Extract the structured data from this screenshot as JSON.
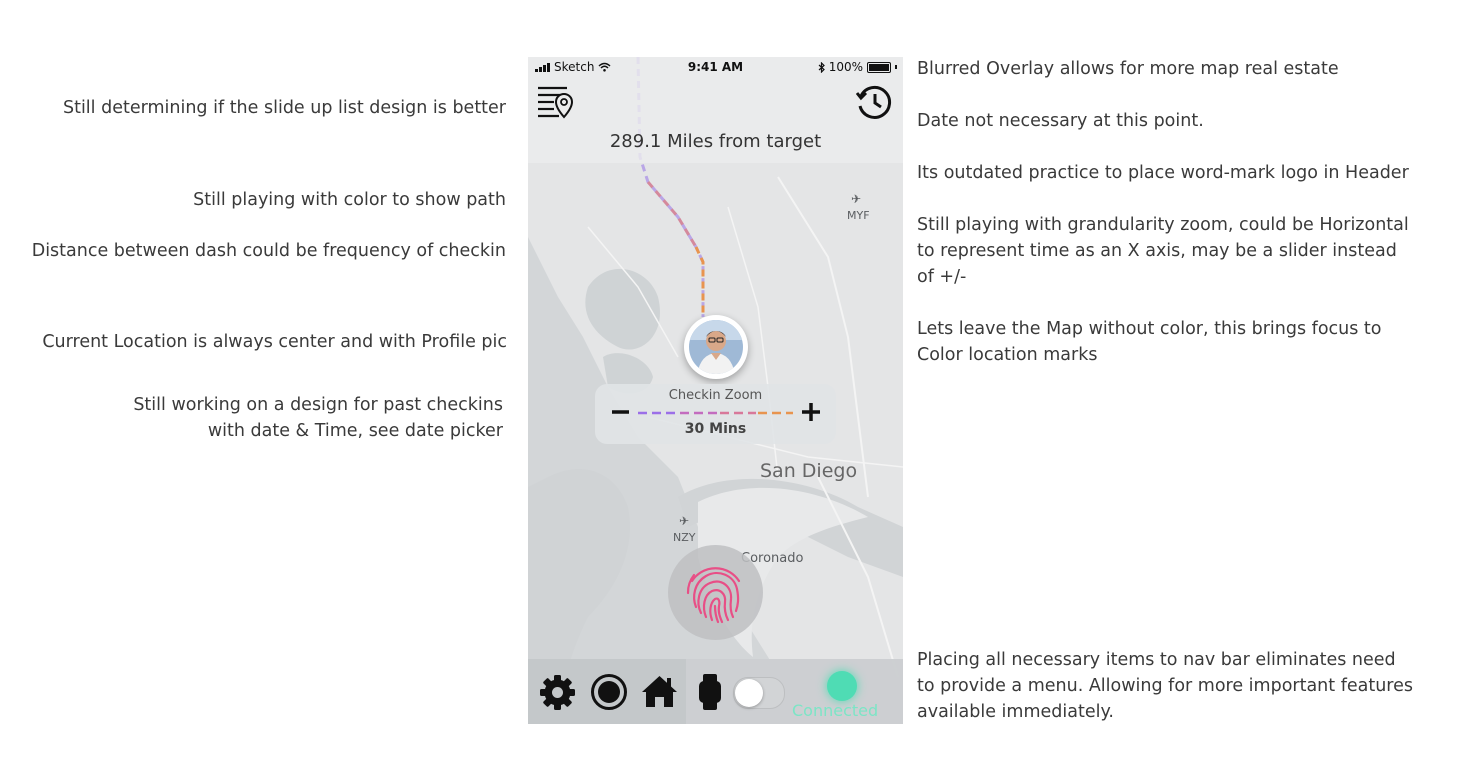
{
  "notes": {
    "left": [
      "Still determining if the slide up list  design is better",
      "Still playing with color to show path",
      "Distance between dash could be frequency of checkin",
      "Current Location is always center and with Profile pic",
      "Still working on a design for past checkins",
      "with date & Time, see date picker"
    ],
    "right": [
      "Blurred Overlay allows for more map real estate",
      "Date not necessary at this point.",
      "Its outdated practice to place word-mark logo in Header",
      "Still playing with grandularity zoom, could be Horizontal to represent time as an X axis, may be a slider instead of +/-",
      "Lets leave the Map  without color, this brings focus to Color location marks",
      "Placing all necessary items to nav bar eliminates need to provide a menu. Allowing for more important features available immediately."
    ]
  },
  "phone": {
    "status": {
      "carrier": "Sketch",
      "time": "9:41 AM",
      "battery": "100%"
    },
    "header": {
      "distance": "289.1 Miles from target",
      "left_icon": "list-location-icon",
      "right_icon": "history-icon"
    },
    "map": {
      "labels": {
        "city": "San Diego",
        "airport1": "MYF",
        "airport2": "NZY",
        "coronado": "Coronado"
      },
      "path_colors": [
        "#b9a6e6",
        "#d4899c",
        "#e8944f"
      ]
    },
    "zoom": {
      "label": "Checkin Zoom",
      "value": "30 Mins",
      "minus_icon": "minus-icon",
      "plus_icon": "plus-icon",
      "dash_colors": [
        "#9b6fe8",
        "#c36cbf",
        "#d8789a",
        "#e8944f"
      ]
    },
    "fingerprint": {
      "icon": "fingerprint-icon",
      "color": "#e84f86"
    },
    "navbar": {
      "icons": [
        "gear-icon",
        "record-icon",
        "home-icon",
        "watch-icon"
      ],
      "toggle_on": false,
      "connected_label": "Connected",
      "connected_color": "#4fdcb4"
    }
  }
}
